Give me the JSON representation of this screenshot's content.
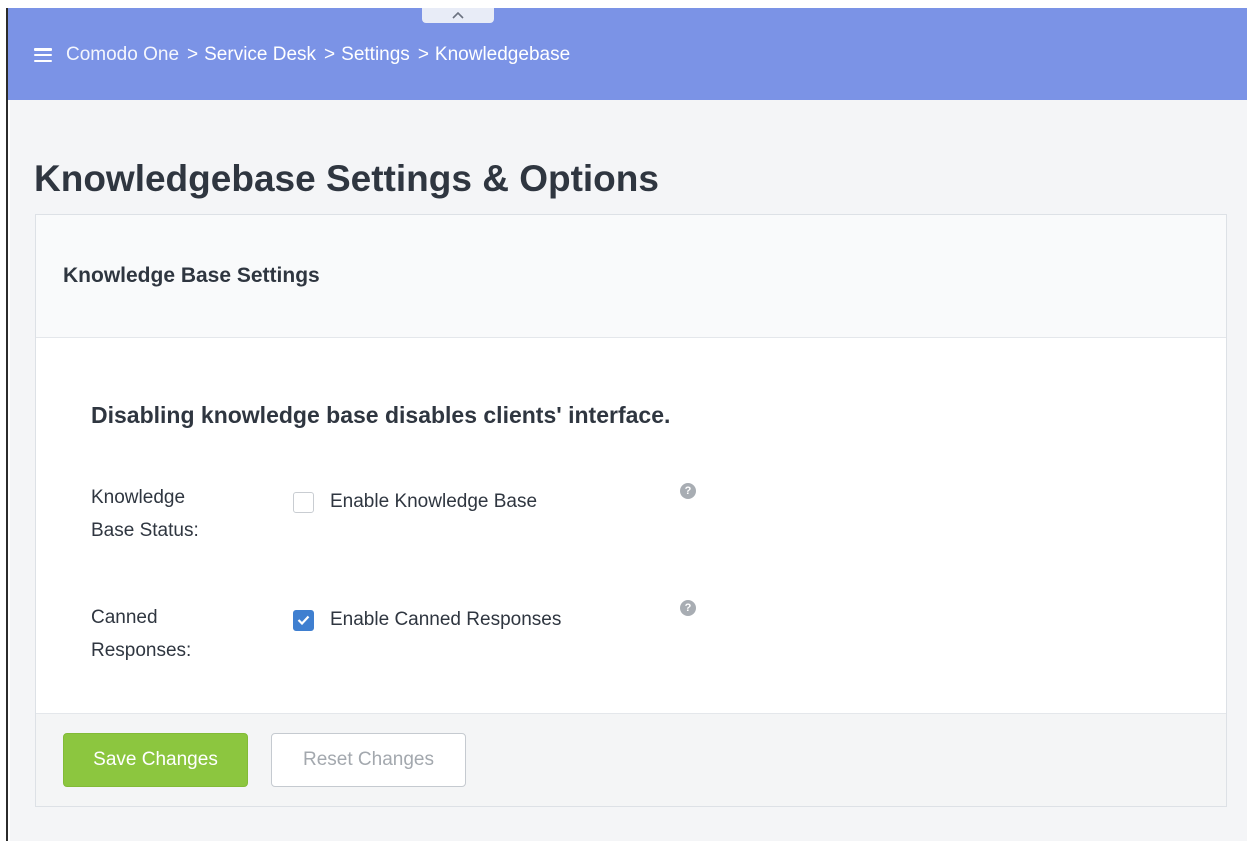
{
  "header": {
    "breadcrumb": [
      {
        "label": "Comodo One"
      },
      {
        "label": "Service Desk"
      },
      {
        "label": "Settings"
      },
      {
        "label": "Knowledgebase"
      }
    ],
    "separator": ">",
    "background_color": "#7b93e6"
  },
  "page": {
    "title": "Knowledgebase Settings & Options"
  },
  "panel": {
    "title": "Knowledge Base Settings",
    "notice": "Disabling knowledge base disables clients' interface.",
    "fields": [
      {
        "label_line1": "Knowledge",
        "label_line2": "Base Status:",
        "option_label": "Enable Knowledge Base",
        "checked": false,
        "help_icon": "question-circle-icon"
      },
      {
        "label_line1": "Canned",
        "label_line2": "Responses:",
        "option_label": "Enable Canned Responses",
        "checked": true,
        "help_icon": "question-circle-icon"
      }
    ],
    "buttons": {
      "save_label": "Save Changes",
      "reset_label": "Reset Changes"
    }
  },
  "colors": {
    "accent_blue": "#3f7fd0",
    "save_green": "#8cc63f"
  }
}
